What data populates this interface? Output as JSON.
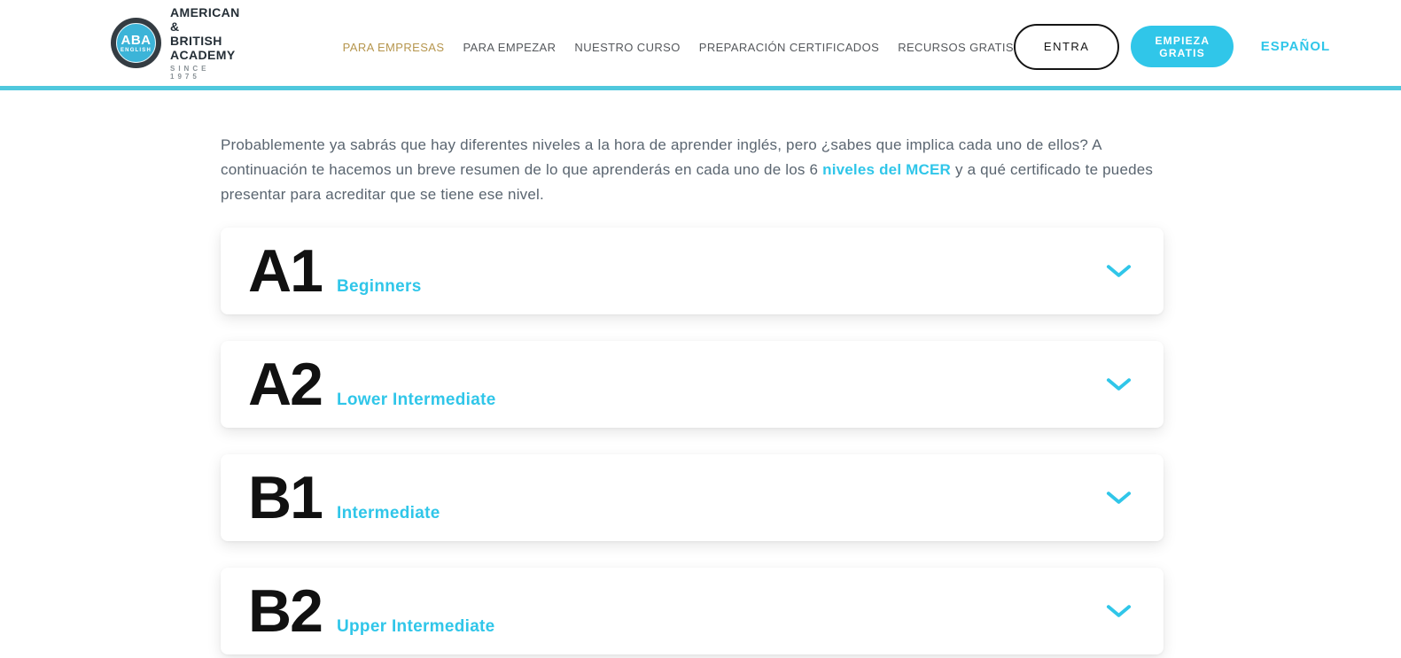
{
  "brand": {
    "circle_top": "ABA",
    "circle_bottom": "ENGLISH",
    "name_line1": "AMERICAN &",
    "name_line2": "BRITISH ACADEMY",
    "tagline": "SINCE 1975"
  },
  "nav": {
    "items": [
      {
        "label": "PARA EMPRESAS",
        "active": true
      },
      {
        "label": "PARA EMPEZAR",
        "active": false
      },
      {
        "label": "NUESTRO CURSO",
        "active": false
      },
      {
        "label": "PREPARACIÓN CERTIFICADOS",
        "active": false
      },
      {
        "label": "RECURSOS GRATIS",
        "active": false
      }
    ],
    "login_label": "ENTRA",
    "cta_label": "EMPIEZA GRATIS",
    "language_label": "ESPAÑOL"
  },
  "intro": {
    "text_before_link": "Probablemente ya sabrás que hay diferentes niveles a la hora de aprender inglés, pero ¿sabes que implica cada uno de ellos? A continuación te hacemos un breve resumen de lo que aprenderás en cada uno de los 6 ",
    "link_text": "niveles del MCER",
    "text_after_link": " y a qué certificado te puedes presentar para acreditar que se tiene ese nivel."
  },
  "levels": [
    {
      "code": "A1",
      "name": "Beginners"
    },
    {
      "code": "A2",
      "name": "Lower Intermediate"
    },
    {
      "code": "B1",
      "name": "Intermediate"
    },
    {
      "code": "B2",
      "name": "Upper Intermediate"
    }
  ],
  "colors": {
    "accent_cyan": "#30c6e9",
    "header_border_cyan": "#4fc8dd",
    "nav_active_gold": "#b6964e",
    "nav_text_gray": "#55585c",
    "body_text": "#5a6570",
    "level_code_black": "#111111"
  }
}
